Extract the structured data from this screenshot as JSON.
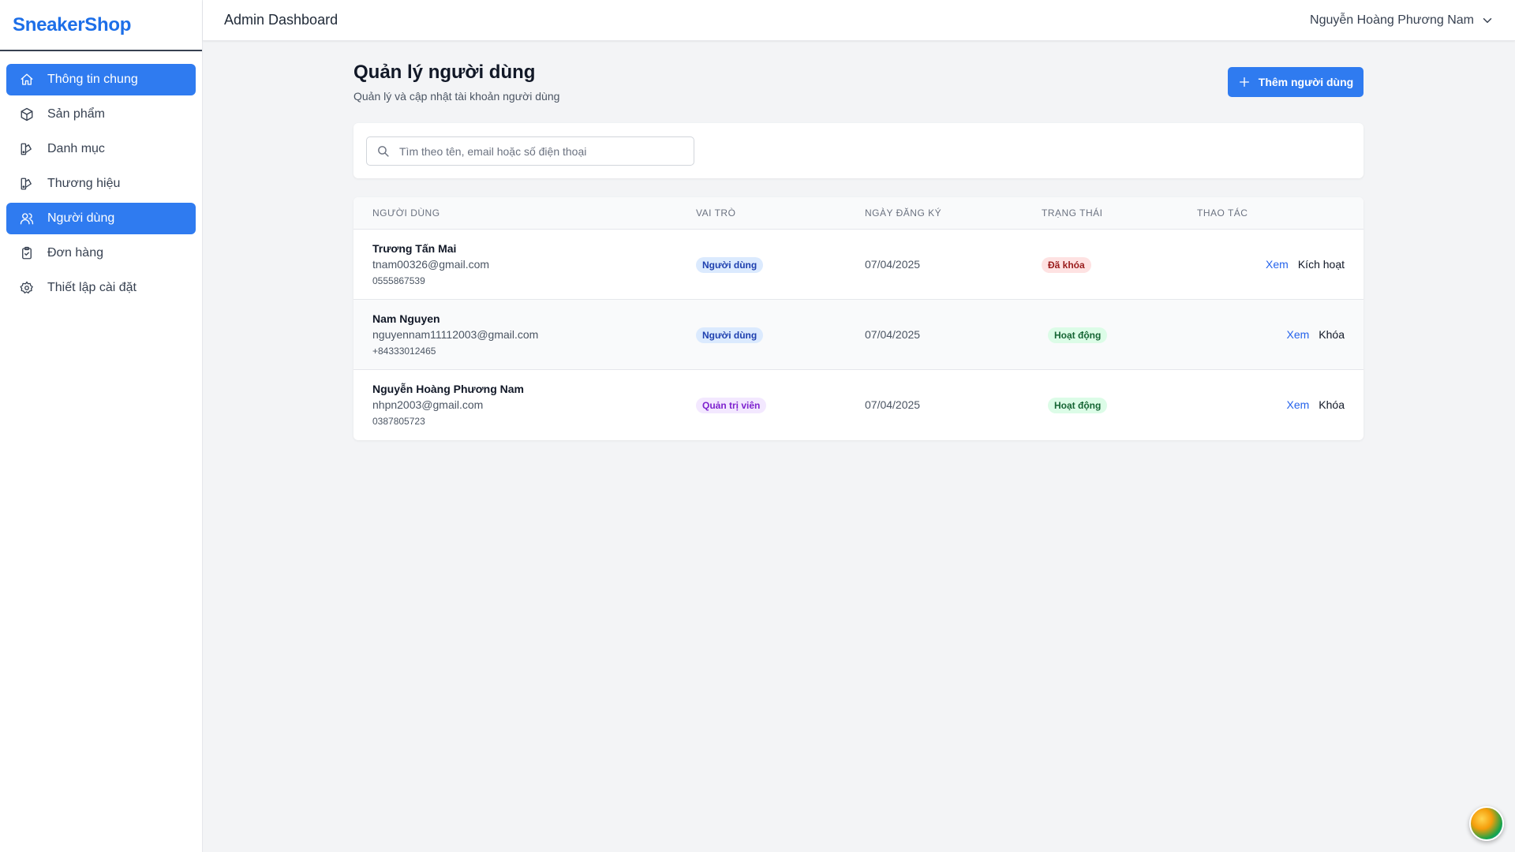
{
  "brand": "SneakerShop",
  "header": {
    "title": "Admin Dashboard",
    "user_name": "Nguyễn Hoàng Phương Nam"
  },
  "sidebar": {
    "items": [
      {
        "label": "Thông tin chung",
        "icon": "home-icon"
      },
      {
        "label": "Sản phẩm",
        "icon": "box-icon"
      },
      {
        "label": "Danh mục",
        "icon": "palette-icon"
      },
      {
        "label": "Thương hiệu",
        "icon": "palette-icon"
      },
      {
        "label": "Người dùng",
        "icon": "users-icon"
      },
      {
        "label": "Đơn hàng",
        "icon": "clipboard-icon"
      },
      {
        "label": "Thiết lập cài đặt",
        "icon": "gear-icon"
      }
    ]
  },
  "page": {
    "title": "Quản lý người dùng",
    "subtitle": "Quản lý và cập nhật tài khoản người dùng",
    "add_button": "Thêm người dùng"
  },
  "search": {
    "placeholder": "Tìm theo tên, email hoặc số điện thoại",
    "value": ""
  },
  "table": {
    "headers": [
      "Người dùng",
      "Vai trò",
      "Ngày đăng ký",
      "Trạng thái",
      "Thao tác"
    ],
    "rows": [
      {
        "name": "Trương Tấn Mai",
        "email": "tnam00326@gmail.com",
        "phone": "0555867539",
        "role": "Người dùng",
        "date": "07/04/2025",
        "status": "Đã khóa",
        "view": "Xem",
        "action": "Kích hoạt"
      },
      {
        "name": "Nam Nguyen",
        "email": "nguyennam11112003@gmail.com",
        "phone": "+84333012465",
        "role": "Người dùng",
        "date": "07/04/2025",
        "status": "Hoạt động",
        "view": "Xem",
        "action": "Khóa"
      },
      {
        "name": "Nguyễn Hoàng Phương Nam",
        "email": "nhpn2003@gmail.com",
        "phone": "0387805723",
        "role": "Quản trị viên",
        "date": "07/04/2025",
        "status": "Hoạt động",
        "view": "Xem",
        "action": "Khóa"
      }
    ]
  },
  "colors": {
    "accent": "#2f7bf0",
    "brand": "#1d6fe8"
  }
}
